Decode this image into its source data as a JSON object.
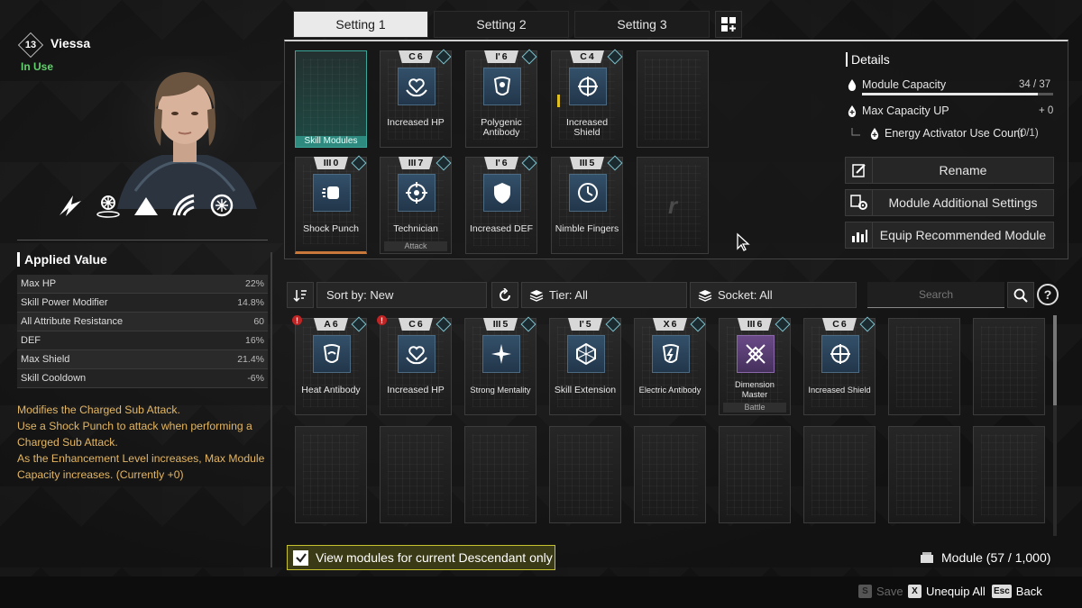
{
  "character": {
    "level": "13",
    "name": "Viessa",
    "status": "In Use"
  },
  "applied_value": {
    "title": "Applied Value",
    "stats": [
      {
        "label": "Max HP",
        "value": "22%"
      },
      {
        "label": "Skill Power Modifier",
        "value": "14.8%"
      },
      {
        "label": "All Attribute Resistance",
        "value": "60"
      },
      {
        "label": "DEF",
        "value": "16%"
      },
      {
        "label": "Max Shield",
        "value": "21.4%"
      },
      {
        "label": "Skill Cooldown",
        "value": "-6%"
      }
    ],
    "description": [
      "Modifies the Charged Sub Attack.",
      "Use a Shock Punch to attack when performing a Charged Sub Attack.",
      "As the Enhancement Level increases, Max Module Capacity increases. (Currently +0)"
    ]
  },
  "tabs": [
    "Setting 1",
    "Setting 2",
    "Setting 3"
  ],
  "equipped": {
    "skill_slot_label": "Skill Modules",
    "top_row": [
      {
        "name": "Increased HP",
        "cost": "6",
        "symbol": "C",
        "icon": "heart-hands-icon"
      },
      {
        "name": "Polygenic Antibody",
        "cost": "6",
        "symbol": "I'",
        "icon": "antibody-icon"
      },
      {
        "name": "Increased Shield",
        "cost": "4",
        "symbol": "C",
        "icon": "shield-cross-icon"
      }
    ],
    "bottom_row": [
      {
        "name": "Shock Punch",
        "cost": "0",
        "symbol": "III",
        "icon": "fist-icon"
      },
      {
        "name": "Technician",
        "cost": "7",
        "symbol": "III",
        "icon": "target-icon",
        "sub": "Attack"
      },
      {
        "name": "Increased DEF",
        "cost": "6",
        "symbol": "I'",
        "icon": "shield-icon"
      },
      {
        "name": "Nimble Fingers",
        "cost": "5",
        "symbol": "III",
        "icon": "clock-icon"
      }
    ],
    "locked_letter": "r"
  },
  "details": {
    "title": "Details",
    "module_capacity_label": "Module Capacity",
    "module_capacity_value": "34 / 37",
    "module_capacity_fraction": 0.919,
    "max_capacity_label": "Max Capacity UP",
    "max_capacity_value": "+ 0",
    "energy_label": "Energy Activator Use Count",
    "energy_value": "(0/1)"
  },
  "actions": {
    "rename": "Rename",
    "additional": "Module Additional Settings",
    "recommend": "Equip Recommended Module"
  },
  "toolbar": {
    "sort": "Sort by: New",
    "tier": "Tier: All",
    "socket": "Socket: All",
    "search_placeholder": "Search",
    "help": "?"
  },
  "inventory": [
    {
      "name": "Heat Antibody",
      "cost": "6",
      "symbol": "A",
      "icon": "antibody-icon",
      "warn": true
    },
    {
      "name": "Increased HP",
      "cost": "6",
      "symbol": "C",
      "icon": "heart-hands-icon",
      "warn": true
    },
    {
      "name": "Strong Mentality",
      "cost": "5",
      "symbol": "III",
      "icon": "sparkle-icon"
    },
    {
      "name": "Skill Extension",
      "cost": "5",
      "symbol": "I'",
      "icon": "hexagon-icon"
    },
    {
      "name": "Electric Antibody",
      "cost": "6",
      "symbol": "X",
      "icon": "lightning-icon"
    },
    {
      "name": "Dimension Master",
      "cost": "6",
      "symbol": "III",
      "icon": "dimension-icon",
      "sub": "Battle",
      "purple": true
    },
    {
      "name": "Increased Shield",
      "cost": "6",
      "symbol": "C",
      "icon": "shield-cross-icon"
    }
  ],
  "bottom": {
    "checkbox_label": "View modules for current Descendant only",
    "module_count": "Module (57 / 1,000)",
    "save_key": "S",
    "save": "Save",
    "unequip_key": "X",
    "unequip": "Unequip All",
    "back_key": "Esc",
    "back": "Back"
  }
}
